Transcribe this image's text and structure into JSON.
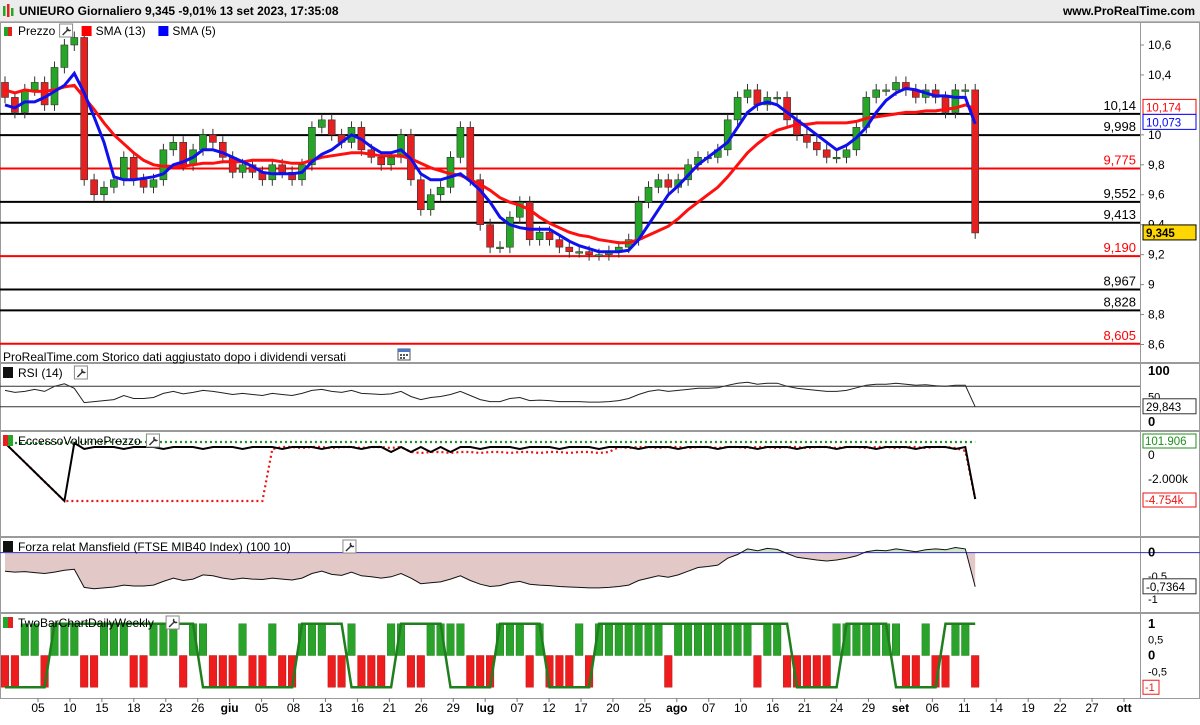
{
  "title": "UNIEURO Giornaliero 9,345 -9,01% 13 set 2023, 17:35:08",
  "site": "www.ProRealTime.com",
  "panels": {
    "price": {
      "legend": [
        {
          "label": "Prezzo",
          "color": "#000000",
          "kind": "candles"
        },
        {
          "label": "SMA (13)",
          "color": "#ff0000",
          "kind": "sma13"
        },
        {
          "label": "SMA (5)",
          "color": "#0000ff",
          "kind": "sma5"
        }
      ],
      "ticks": [
        "10,6",
        "10,4",
        "10",
        "9,8",
        "9,6",
        "9,4",
        "9,2",
        "9",
        "8,8",
        "8,6"
      ],
      "hlines": [
        {
          "label": "10,14",
          "value": 10.14,
          "color": "#000000"
        },
        {
          "label": "9,998",
          "value": 9.998,
          "color": "#000000"
        },
        {
          "label": "9,775",
          "value": 9.775,
          "color": "#ff0000"
        },
        {
          "label": "9,552",
          "value": 9.552,
          "color": "#000000"
        },
        {
          "label": "9,413",
          "value": 9.413,
          "color": "#000000"
        },
        {
          "label": "9,190",
          "value": 9.19,
          "color": "#ff0000"
        },
        {
          "label": "8,967",
          "value": 8.967,
          "color": "#000000"
        },
        {
          "label": "8,828",
          "value": 8.828,
          "color": "#000000"
        },
        {
          "label": "8,605",
          "value": 8.605,
          "color": "#ff0000"
        }
      ],
      "badges": [
        {
          "label": "10,174",
          "value": 10.174,
          "color": "#ff0000",
          "bg": "#ffffff"
        },
        {
          "label": "10,073",
          "value": 10.073,
          "color": "#0000ff",
          "bg": "#ffffff"
        },
        {
          "label": "9,345",
          "value": 9.345,
          "color": "#000000",
          "bg": "#ffd700"
        }
      ],
      "note": "ProRealTime.com  Storico dati aggiustato dopo i dividendi versati"
    },
    "rsi": {
      "legend": "RSI (14)",
      "ticks": [
        "100",
        "50",
        "0"
      ],
      "value": "29,843"
    },
    "volume": {
      "legend": "EccessoVolumePrezzo",
      "ticks": [
        "0",
        "-2.000k"
      ],
      "value_top": "101.906",
      "value_bottom": "-4.754k"
    },
    "mansfield": {
      "legend": "Forza relat Mansfield (FTSE MIB40 Index) (100 10)",
      "ticks": [
        "0",
        "-0,5",
        "-1"
      ],
      "value": "-0,7364"
    },
    "twobar": {
      "legend": "TwoBarChartDailyWeekly",
      "ticks": [
        "1",
        "0,5",
        "0",
        "-0,5",
        "-1"
      ],
      "value": "-1"
    }
  },
  "xaxis": [
    {
      "label": "05",
      "bold": false
    },
    {
      "label": "10",
      "bold": false
    },
    {
      "label": "15",
      "bold": false
    },
    {
      "label": "18",
      "bold": false
    },
    {
      "label": "23",
      "bold": false
    },
    {
      "label": "26",
      "bold": false
    },
    {
      "label": "giu",
      "bold": true
    },
    {
      "label": "05",
      "bold": false
    },
    {
      "label": "08",
      "bold": false
    },
    {
      "label": "13",
      "bold": false
    },
    {
      "label": "16",
      "bold": false
    },
    {
      "label": "21",
      "bold": false
    },
    {
      "label": "26",
      "bold": false
    },
    {
      "label": "29",
      "bold": false
    },
    {
      "label": "lug",
      "bold": true
    },
    {
      "label": "07",
      "bold": false
    },
    {
      "label": "12",
      "bold": false
    },
    {
      "label": "17",
      "bold": false
    },
    {
      "label": "20",
      "bold": false
    },
    {
      "label": "25",
      "bold": false
    },
    {
      "label": "ago",
      "bold": true
    },
    {
      "label": "07",
      "bold": false
    },
    {
      "label": "10",
      "bold": false
    },
    {
      "label": "16",
      "bold": false
    },
    {
      "label": "21",
      "bold": false
    },
    {
      "label": "24",
      "bold": false
    },
    {
      "label": "29",
      "bold": false
    },
    {
      "label": "set",
      "bold": true
    },
    {
      "label": "06",
      "bold": false
    },
    {
      "label": "11",
      "bold": false
    },
    {
      "label": "14",
      "bold": false
    },
    {
      "label": "19",
      "bold": false
    },
    {
      "label": "22",
      "bold": false
    },
    {
      "label": "27",
      "bold": false
    },
    {
      "label": "ott",
      "bold": true
    }
  ],
  "chart_data": {
    "type": "candlestick",
    "price_ylim": [
      8.55,
      10.7
    ],
    "closes": [
      10.25,
      10.15,
      10.3,
      10.35,
      10.2,
      10.45,
      10.6,
      10.65,
      9.7,
      9.6,
      9.65,
      9.7,
      9.85,
      9.7,
      9.65,
      9.7,
      9.9,
      9.95,
      9.8,
      9.9,
      10.0,
      9.95,
      9.85,
      9.75,
      9.8,
      9.75,
      9.7,
      9.8,
      9.75,
      9.7,
      9.8,
      10.05,
      10.1,
      10.0,
      9.95,
      10.05,
      9.9,
      9.85,
      9.8,
      9.85,
      10.0,
      9.7,
      9.5,
      9.6,
      9.65,
      9.85,
      10.05,
      9.7,
      9.4,
      9.25,
      9.25,
      9.45,
      9.55,
      9.3,
      9.35,
      9.3,
      9.25,
      9.22,
      9.22,
      9.2,
      9.2,
      9.22,
      9.25,
      9.3,
      9.55,
      9.65,
      9.7,
      9.65,
      9.7,
      9.8,
      9.85,
      9.85,
      9.9,
      10.1,
      10.25,
      10.3,
      10.2,
      10.25,
      10.25,
      10.1,
      10.0,
      9.95,
      9.9,
      9.85,
      9.85,
      9.9,
      10.05,
      10.25,
      10.3,
      10.3,
      10.35,
      10.3,
      10.25,
      10.3,
      10.25,
      10.15,
      10.3,
      10.3,
      9.345
    ],
    "sma13": [
      10.3,
      10.28,
      10.3,
      10.29,
      10.29,
      10.3,
      10.32,
      10.33,
      10.25,
      10.17,
      10.08,
      10.0,
      9.94,
      9.88,
      9.83,
      9.8,
      9.79,
      9.79,
      9.79,
      9.8,
      9.81,
      9.81,
      9.82,
      9.82,
      9.82,
      9.83,
      9.83,
      9.83,
      9.82,
      9.81,
      9.81,
      9.83,
      9.85,
      9.86,
      9.87,
      9.88,
      9.88,
      9.87,
      9.86,
      9.86,
      9.86,
      9.84,
      9.81,
      9.78,
      9.76,
      9.74,
      9.73,
      9.7,
      9.67,
      9.63,
      9.58,
      9.55,
      9.53,
      9.5,
      9.45,
      9.41,
      9.38,
      9.35,
      9.33,
      9.32,
      9.3,
      9.29,
      9.28,
      9.28,
      9.3,
      9.33,
      9.36,
      9.39,
      9.44,
      9.5,
      9.55,
      9.6,
      9.65,
      9.72,
      9.8,
      9.88,
      9.94,
      9.99,
      10.03,
      10.05,
      10.07,
      10.07,
      10.08,
      10.08,
      10.08,
      10.08,
      10.09,
      10.11,
      10.12,
      10.13,
      10.14,
      10.15,
      10.15,
      10.16,
      10.16,
      10.17,
      10.18,
      10.2,
      10.174
    ],
    "sma5": [
      10.2,
      10.18,
      10.22,
      10.22,
      10.25,
      10.29,
      10.33,
      10.41,
      10.28,
      10.12,
      9.95,
      9.72,
      9.7,
      9.7,
      9.71,
      9.72,
      9.74,
      9.8,
      9.82,
      9.85,
      9.9,
      9.9,
      9.88,
      9.85,
      9.82,
      9.79,
      9.75,
      9.74,
      9.74,
      9.74,
      9.75,
      9.82,
      9.87,
      9.9,
      9.95,
      10.0,
      9.97,
      9.92,
      9.88,
      9.88,
      9.9,
      9.84,
      9.74,
      9.7,
      9.7,
      9.72,
      9.74,
      9.69,
      9.63,
      9.55,
      9.45,
      9.4,
      9.38,
      9.37,
      9.37,
      9.37,
      9.33,
      9.29,
      9.26,
      9.24,
      9.22,
      9.22,
      9.22,
      9.23,
      9.3,
      9.4,
      9.5,
      9.6,
      9.66,
      9.73,
      9.8,
      9.85,
      9.9,
      9.95,
      10.05,
      10.15,
      10.2,
      10.22,
      10.2,
      10.15,
      10.1,
      10.05,
      10.0,
      9.95,
      9.9,
      9.93,
      9.98,
      10.05,
      10.15,
      10.23,
      10.28,
      10.31,
      10.3,
      10.28,
      10.26,
      10.26,
      10.25,
      10.25,
      10.073
    ],
    "rsi": [
      62,
      58,
      60,
      64,
      60,
      70,
      75,
      66,
      38,
      40,
      42,
      44,
      52,
      46,
      46,
      48,
      56,
      60,
      55,
      58,
      62,
      60,
      57,
      54,
      56,
      54,
      52,
      56,
      54,
      52,
      56,
      62,
      64,
      60,
      58,
      62,
      56,
      55,
      54,
      55,
      60,
      50,
      44,
      48,
      50,
      54,
      60,
      52,
      44,
      40,
      40,
      46,
      48,
      42,
      43,
      42,
      40,
      40,
      40,
      39,
      39,
      40,
      42,
      46,
      54,
      60,
      63,
      60,
      62,
      64,
      66,
      66,
      67,
      72,
      76,
      78,
      74,
      76,
      76,
      70,
      66,
      64,
      62,
      60,
      60,
      62,
      67,
      72,
      74,
      74,
      76,
      74,
      72,
      73,
      71,
      70,
      72,
      72,
      29.843
    ],
    "rsi_ylim": [
      0,
      100
    ],
    "mansfield": [
      -0.4,
      -0.42,
      -0.41,
      -0.43,
      -0.45,
      -0.42,
      -0.38,
      -0.36,
      -0.75,
      -0.78,
      -0.76,
      -0.74,
      -0.7,
      -0.72,
      -0.72,
      -0.7,
      -0.62,
      -0.55,
      -0.6,
      -0.57,
      -0.48,
      -0.5,
      -0.55,
      -0.58,
      -0.55,
      -0.57,
      -0.58,
      -0.55,
      -0.57,
      -0.59,
      -0.55,
      -0.45,
      -0.4,
      -0.47,
      -0.49,
      -0.42,
      -0.5,
      -0.52,
      -0.55,
      -0.52,
      -0.45,
      -0.55,
      -0.67,
      -0.65,
      -0.63,
      -0.57,
      -0.5,
      -0.6,
      -0.68,
      -0.73,
      -0.71,
      -0.65,
      -0.62,
      -0.68,
      -0.7,
      -0.71,
      -0.73,
      -0.74,
      -0.75,
      -0.76,
      -0.76,
      -0.75,
      -0.73,
      -0.7,
      -0.6,
      -0.55,
      -0.5,
      -0.53,
      -0.48,
      -0.4,
      -0.32,
      -0.3,
      -0.27,
      -0.12,
      -0.04,
      0.08,
      0.04,
      0.09,
      0.07,
      -0.02,
      -0.1,
      -0.13,
      -0.16,
      -0.18,
      -0.16,
      -0.12,
      -0.07,
      0.02,
      0.05,
      0.04,
      0.08,
      0.05,
      0.02,
      0.06,
      0.08,
      0.06,
      0.11,
      0.08,
      -0.7364
    ],
    "mansfield_ylim": [
      -1.15,
      0.25
    ],
    "twobar_ylim": [
      -1.15,
      1.15
    ]
  }
}
